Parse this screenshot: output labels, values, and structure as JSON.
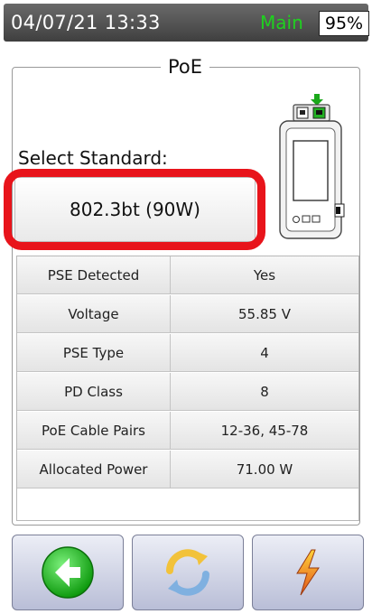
{
  "status": {
    "datetime": "04/07/21 13:33",
    "mode": "Main",
    "battery": "95%"
  },
  "panel": {
    "title": "PoE",
    "select_label": "Select Standard:",
    "selected_standard": "802.3bt (90W)"
  },
  "table": {
    "rows": [
      {
        "label": "PSE Detected",
        "value": "Yes"
      },
      {
        "label": "Voltage",
        "value": "55.85 V"
      },
      {
        "label": "PSE Type",
        "value": "4"
      },
      {
        "label": "PD Class",
        "value": "8"
      },
      {
        "label": "PoE Cable Pairs",
        "value": "12-36, 45-78"
      },
      {
        "label": "Allocated Power",
        "value": "71.00 W"
      }
    ]
  },
  "buttons": {
    "back_icon": "back-arrow-icon",
    "refresh_icon": "refresh-icon",
    "power_icon": "lightning-icon"
  },
  "colors": {
    "mode_green": "#1fd11f",
    "highlight_red": "#e8141b",
    "status_bar": "#4a4a4a",
    "button_blue": "#b9bed7"
  }
}
